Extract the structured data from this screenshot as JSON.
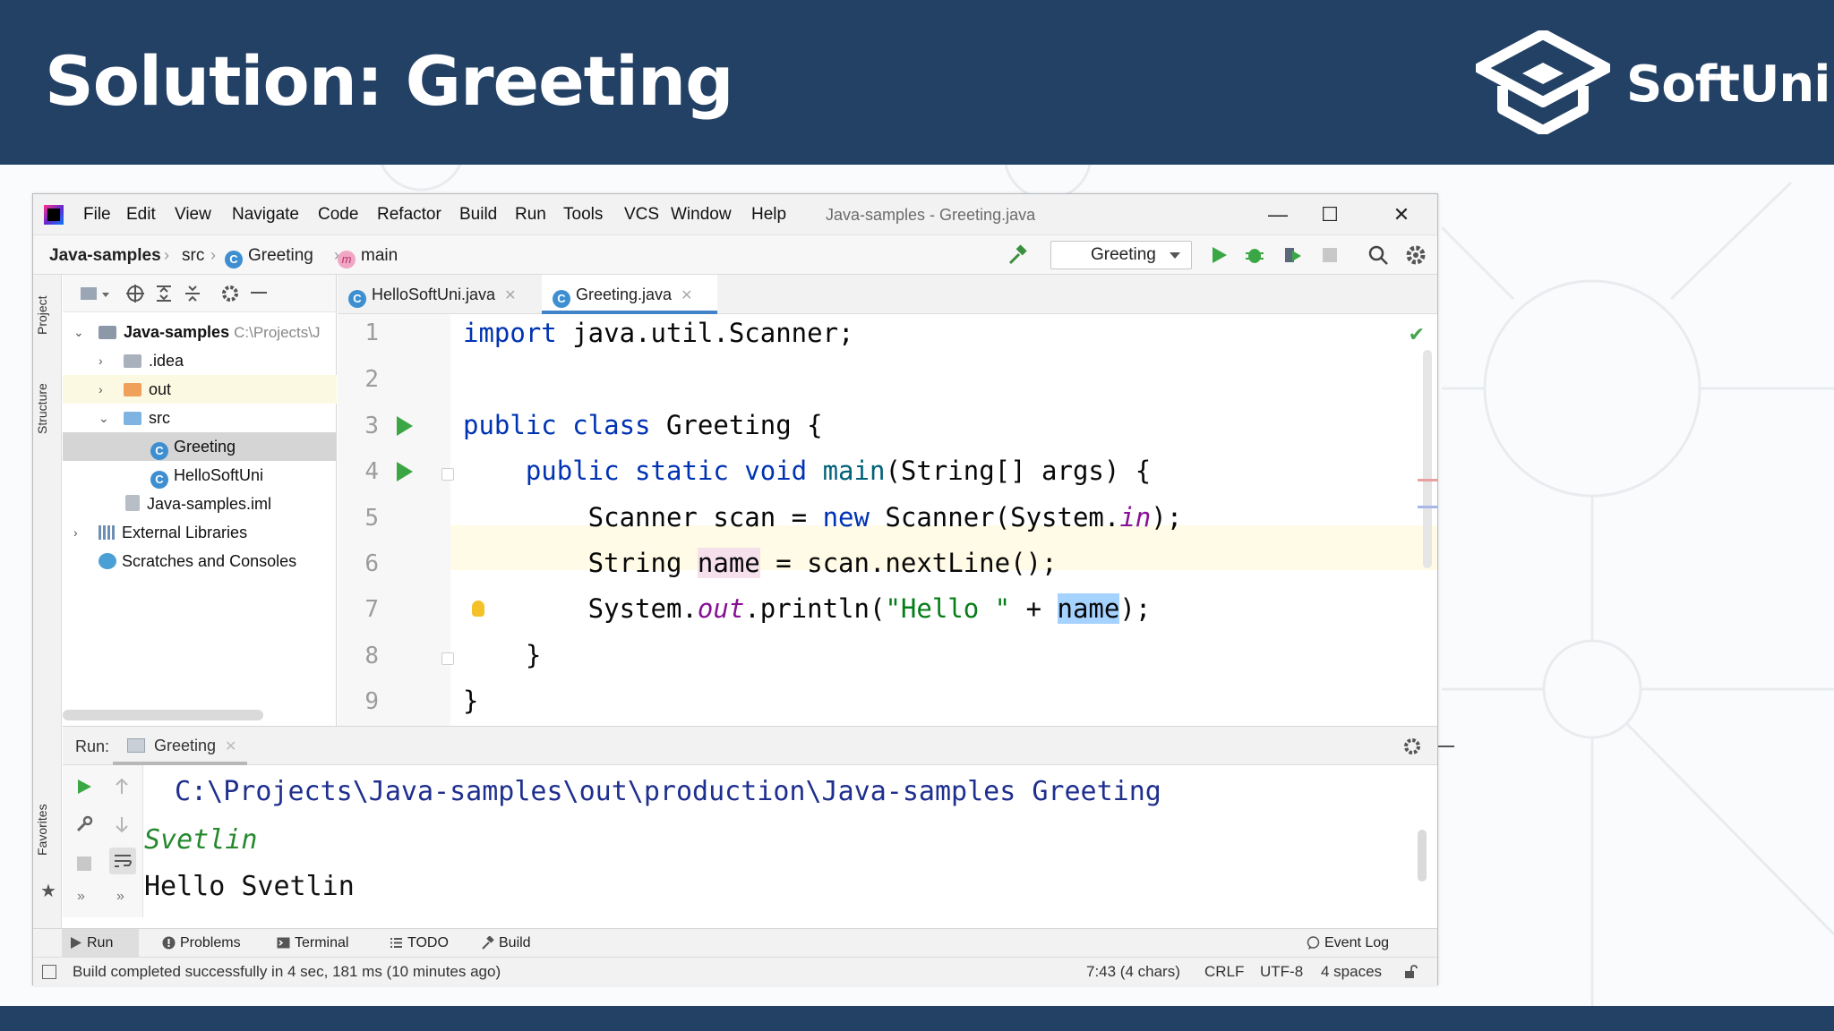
{
  "slide": {
    "title": "Solution: Greeting",
    "brand": "SoftUni",
    "colors": {
      "header": "#234165",
      "footer": "#234165"
    }
  },
  "ide": {
    "menu": [
      "File",
      "Edit",
      "View",
      "Navigate",
      "Code",
      "Refactor",
      "Build",
      "Run",
      "Tools",
      "VCS",
      "Window",
      "Help"
    ],
    "window_title": "Java-samples - Greeting.java",
    "breadcrumb": [
      "Java-samples",
      "src",
      "Greeting",
      "main"
    ],
    "run_config": "Greeting",
    "side_tabs": {
      "project": "Project",
      "structure": "Structure",
      "favorites": "Favorites"
    },
    "project_tree": {
      "root": {
        "label": "Java-samples",
        "path": "C:\\Projects\\J"
      },
      "idea": ".idea",
      "out": "out",
      "src": "src",
      "greeting": "Greeting",
      "hello": "HelloSoftUni",
      "iml": "Java-samples.iml",
      "external": "External Libraries",
      "scratches": "Scratches and Consoles"
    },
    "editor_tabs": [
      "HelloSoftUni.java",
      "Greeting.java"
    ],
    "active_tab": "Greeting.java",
    "line_numbers": [
      "1",
      "2",
      "3",
      "4",
      "5",
      "6",
      "7",
      "8",
      "9"
    ],
    "code": {
      "l1_kw": "import",
      "l1_rest": " java.util.Scanner;",
      "l3_kw": "public class",
      "l3_rest": " Greeting {",
      "l4_indent": "    ",
      "l4_kw": "public static void",
      "l4_sp": " ",
      "l4_fn": "main",
      "l4_rest": "(String[] args) {",
      "l5_a": "        Scanner scan = ",
      "l5_kw": "new",
      "l5_b": " Scanner(System.",
      "l5_it": "in",
      "l5_c": ");",
      "l6_a": "        String ",
      "l6_var": "name",
      "l6_b": " = scan.nextLine();",
      "l7_a": "        System.",
      "l7_it": "out",
      "l7_b": ".println(",
      "l7_str": "\"Hello \"",
      "l7_c": " + ",
      "l7_sel": "name",
      "l7_d": ");",
      "l8": "    }",
      "l9": "}"
    },
    "run_panel": {
      "label": "Run:",
      "tab": "Greeting",
      "console_path": " C:\\Projects\\Java-samples\\out\\production\\Java-samples Greeting",
      "console_input": "Svetlin",
      "console_output": "Hello Svetlin"
    },
    "tool_tabs": [
      "Run",
      "Problems",
      "Terminal",
      "TODO",
      "Build"
    ],
    "event_log": "Event Log",
    "status": {
      "message": "Build completed successfully in 4 sec, 181 ms (10 minutes ago)",
      "position": "7:43 (4 chars)",
      "line_sep": "CRLF",
      "encoding": "UTF-8",
      "indent": "4 spaces"
    }
  }
}
